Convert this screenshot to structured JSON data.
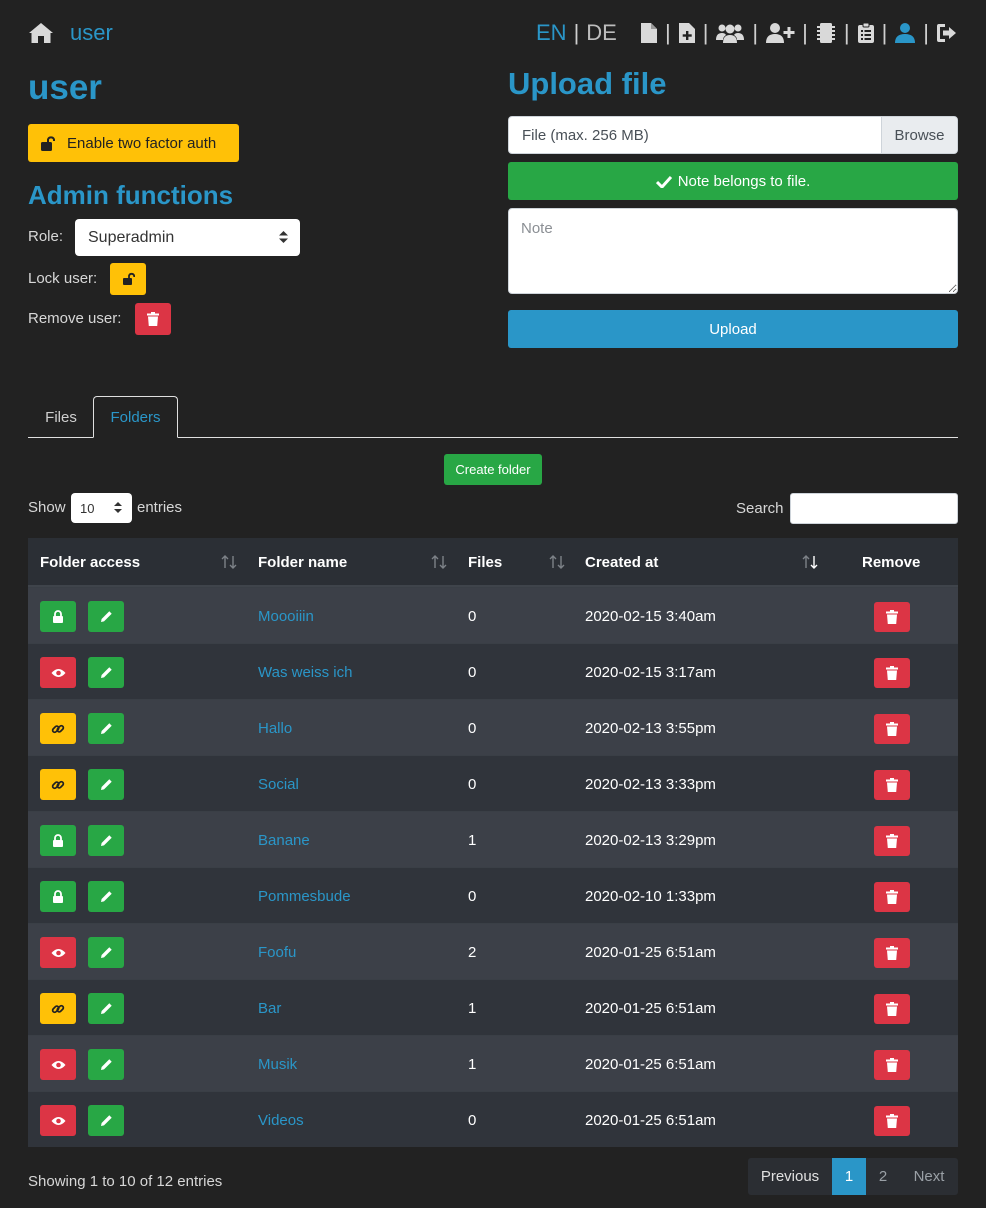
{
  "header": {
    "user_label": "user",
    "lang_en": "EN",
    "lang_divider": "|",
    "lang_de": "DE",
    "nav_icons": [
      "file-icon",
      "file-plus-icon",
      "users-icon",
      "user-plus-icon",
      "sd-card-icon",
      "clipboard-list-icon",
      "user-icon",
      "sign-out-icon"
    ]
  },
  "left": {
    "title": "user",
    "two_factor_label": "Enable two factor auth",
    "admin_title": "Admin functions",
    "role_label": "Role:",
    "role_value": "Superadmin",
    "lock_label": "Lock user:",
    "remove_label": "Remove user:"
  },
  "upload": {
    "title": "Upload file",
    "file_placeholder": "File (max. 256 MB)",
    "browse_label": "Browse",
    "note_toggle_label": "Note belongs to file.",
    "note_placeholder": "Note",
    "upload_label": "Upload"
  },
  "tabs": [
    {
      "label": "Files",
      "active": false
    },
    {
      "label": "Folders",
      "active": true
    }
  ],
  "folders": {
    "create_label": "Create folder",
    "show_label": "Show",
    "entries_value": "10",
    "entries_label": "entries",
    "search_label": "Search",
    "columns": [
      "Folder access",
      "Folder name",
      "Files",
      "Created at",
      "Remove"
    ],
    "rows": [
      {
        "access": "private",
        "name": "Moooiiin",
        "files": "0",
        "created": "2020-02-15 3:40am"
      },
      {
        "access": "public",
        "name": "Was weiss ich",
        "files": "0",
        "created": "2020-02-15 3:17am"
      },
      {
        "access": "link",
        "name": "Hallo",
        "files": "0",
        "created": "2020-02-13 3:55pm"
      },
      {
        "access": "link",
        "name": "Social",
        "files": "0",
        "created": "2020-02-13 3:33pm"
      },
      {
        "access": "private",
        "name": "Banane",
        "files": "1",
        "created": "2020-02-13 3:29pm"
      },
      {
        "access": "private",
        "name": "Pommesbude",
        "files": "0",
        "created": "2020-02-10 1:33pm"
      },
      {
        "access": "public",
        "name": "Foofu",
        "files": "2",
        "created": "2020-01-25 6:51am"
      },
      {
        "access": "link",
        "name": "Bar",
        "files": "1",
        "created": "2020-01-25 6:51am"
      },
      {
        "access": "public",
        "name": "Musik",
        "files": "1",
        "created": "2020-01-25 6:51am"
      },
      {
        "access": "public",
        "name": "Videos",
        "files": "0",
        "created": "2020-01-25 6:51am"
      }
    ],
    "info": "Showing 1 to 10 of 12 entries",
    "pagination": {
      "previous": "Previous",
      "pages": [
        "1",
        "2"
      ],
      "current": "1",
      "next": "Next"
    }
  },
  "colors": {
    "accent": "#2a96c8",
    "success": "#28a745",
    "warning": "#ffc107",
    "danger": "#dc3545",
    "background": "#222222"
  }
}
